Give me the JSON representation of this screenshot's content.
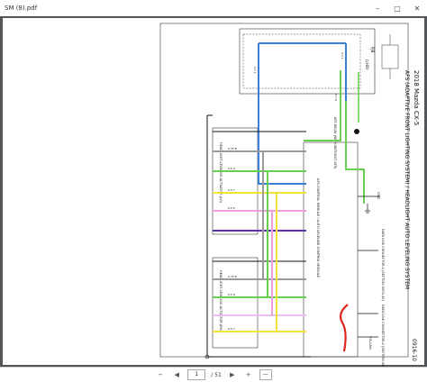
{
  "window": {
    "title": "SM (8).pdf",
    "minimize": "–",
    "maximize": "□",
    "close": "✕"
  },
  "diagram": {
    "code": "0916-10",
    "title_model": "2018 Mazda CX-5",
    "title_system": "AFS (ADAPTIVE FRONT LIGHTING SYSTEM) / HEADLIGHT AUTO LEVELING SYSTEM",
    "top_box_label": "PJB",
    "fuse_label": "(LHD)",
    "afs_relay": "AFS RELAY (WITH/WITHOUT AFS)",
    "afs_module": "AFS CONTROL MODULE / AUTO LEVELING CONTROL MODULE",
    "actuator_lh": "HEADLIGHT LEVELING ACTUATOR (LH)",
    "actuator_rh": "HEADLIGHT LEVELING ACTUATOR (RH)",
    "dlc": "DATA LINK CONNECTOR-2 (SECTION 0003-10)",
    "hs_can": "HS-CAN",
    "gnd": "GND",
    "wire_codes": [
      "0.75 B",
      "0.5 G",
      "0.5 L",
      "0.5 Y",
      "0.5 W",
      "0.5 R",
      "0.5 P"
    ]
  },
  "toolbar": {
    "zoom_out": "−",
    "page_current": "1",
    "page_total": "/ 51",
    "zoom_in": "+",
    "zoom_level": "—"
  }
}
